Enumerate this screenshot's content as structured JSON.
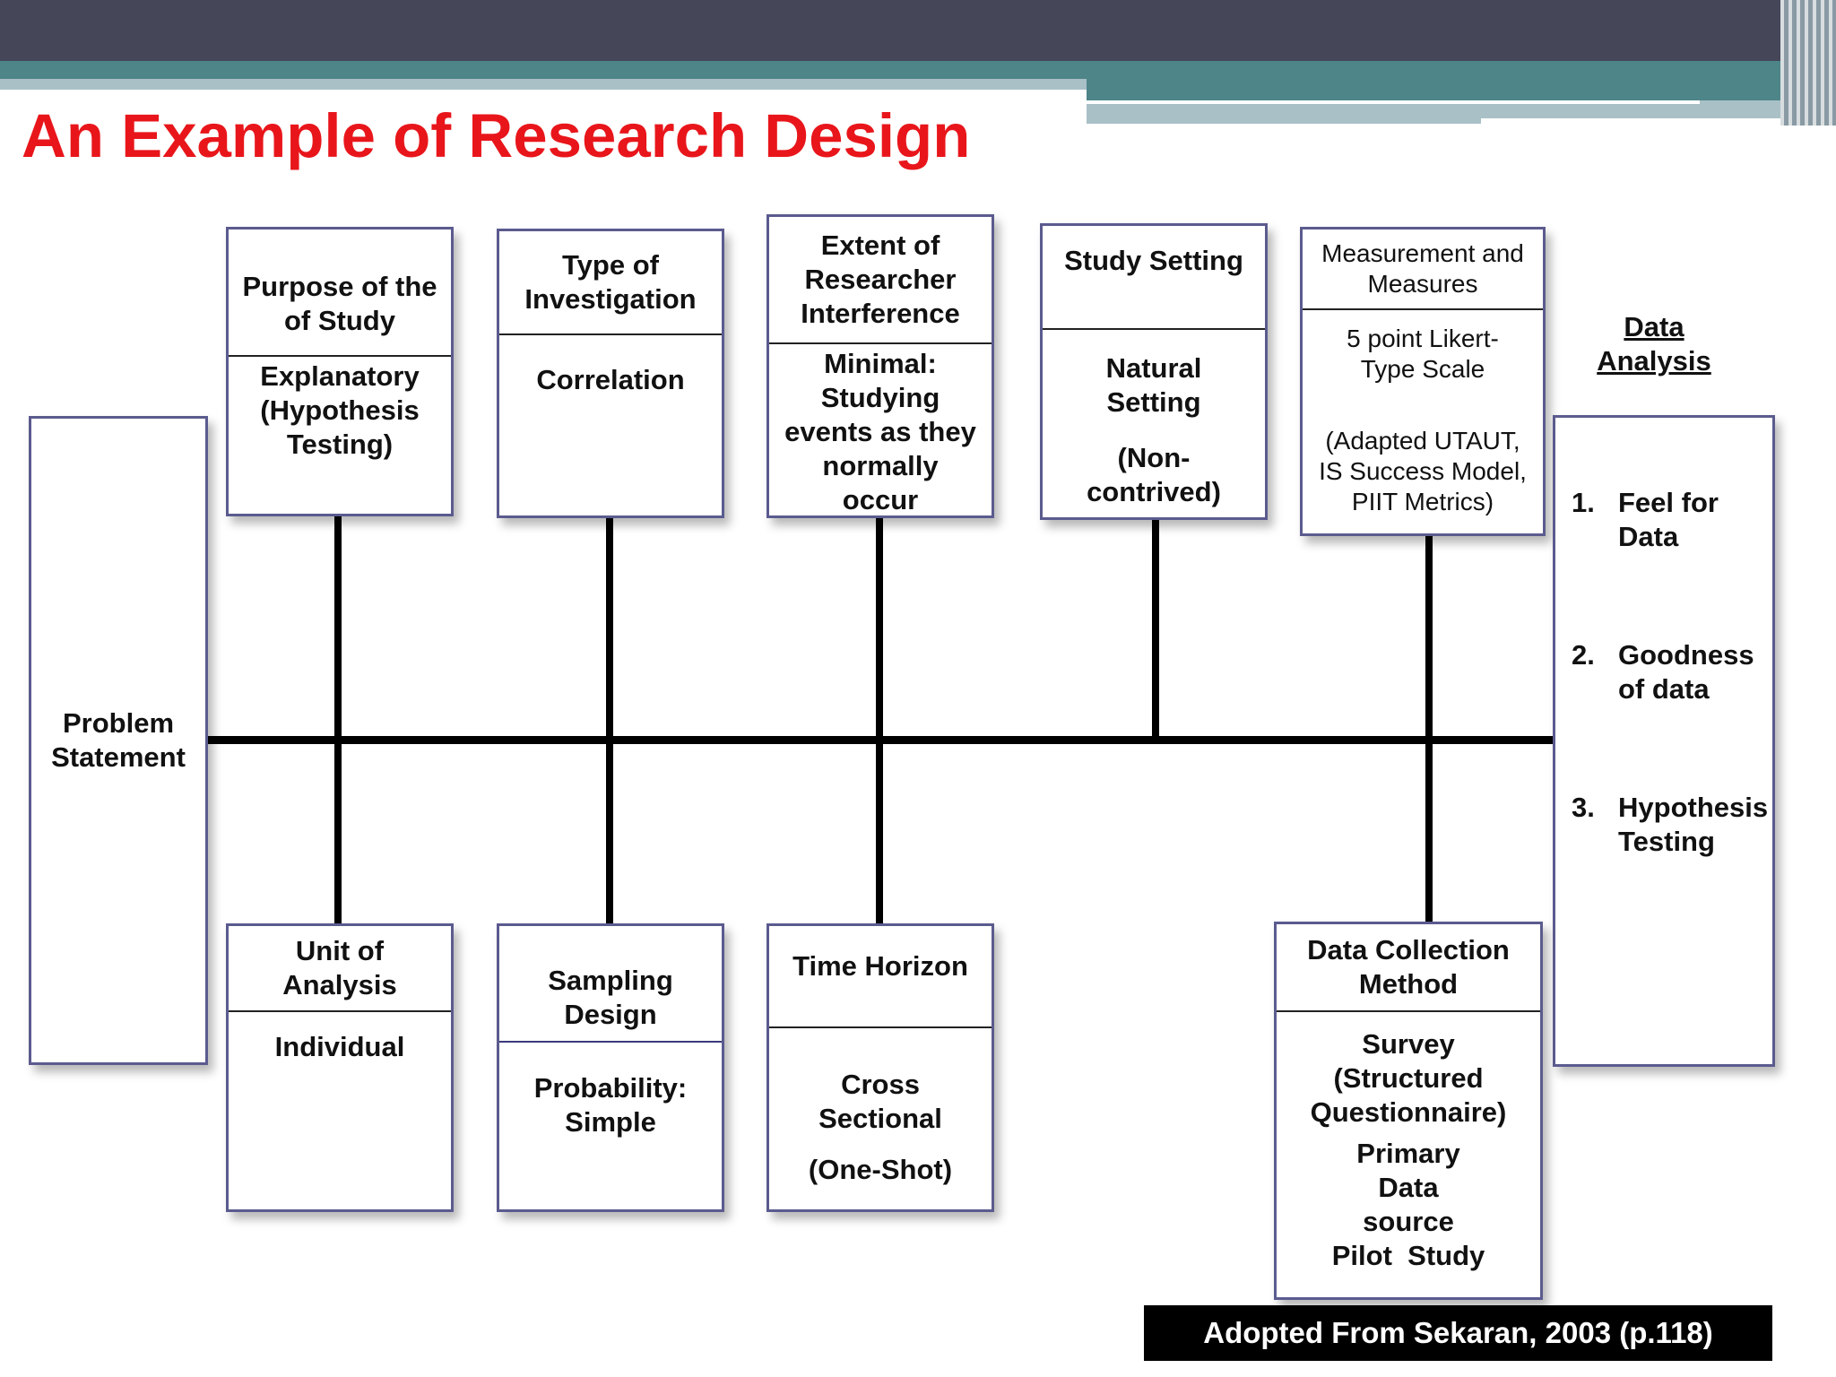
{
  "title": "An Example of Research Design",
  "colors": {
    "title": "#e8161b",
    "header_dark": "#454759",
    "header_teal": "#4e8589",
    "header_light": "#a9c0c6",
    "box_border": "#5b5b8f"
  },
  "problem_statement": "Problem Statement",
  "top_boxes": [
    {
      "header": "Purpose of the of Study",
      "body": "Explanatory (Hypothesis Testing)"
    },
    {
      "header": "Type of Investigation",
      "body": "Correlation"
    },
    {
      "header": "Extent of Researcher Interference",
      "body": "Minimal: Studying events as they normally occur"
    },
    {
      "header": "Study Setting",
      "body": "Natural Setting",
      "body2": "(Non-contrived)"
    },
    {
      "header": "Measurement and Measures",
      "body": "5 point Likert-Type Scale",
      "body2": "(Adapted UTAUT, IS Success Model, PIIT Metrics)"
    }
  ],
  "bottom_boxes": [
    {
      "header": "Unit of Analysis",
      "body": "Individual"
    },
    {
      "header": "Sampling Design",
      "body": "Probability: Simple"
    },
    {
      "header": "Time Horizon",
      "body": "Cross Sectional",
      "body2": "(One-Shot)"
    },
    {
      "header": "Data Collection Method",
      "body": "Survey (Structured Questionnaire)",
      "body2": "Primary Data source",
      "body3": "Pilot  Study"
    }
  ],
  "data_analysis": {
    "title": "Data Analysis",
    "items": [
      {
        "num": "1.",
        "text": "Feel for Data"
      },
      {
        "num": "2.",
        "text": "Goodness of data"
      },
      {
        "num": "3.",
        "text": "Hypothesis Testing"
      }
    ]
  },
  "citation": "Adopted From Sekaran, 2003 (p.118)"
}
